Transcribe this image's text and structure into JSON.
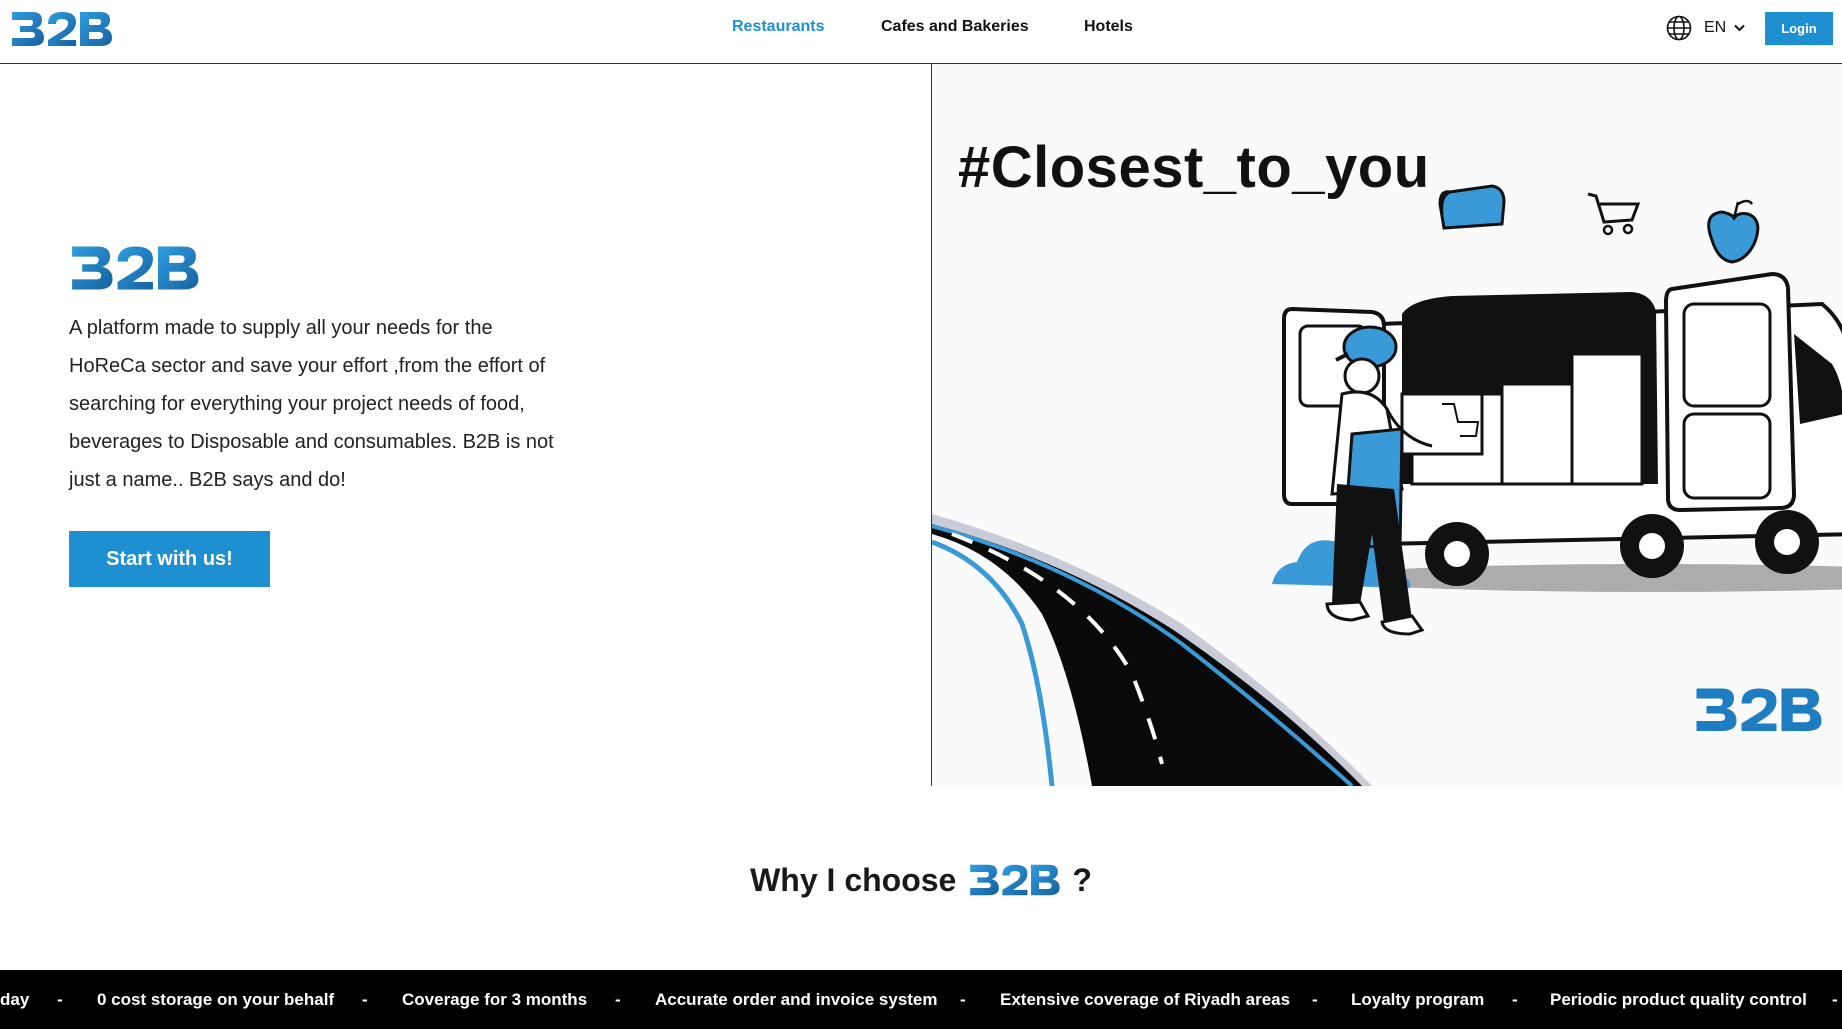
{
  "brand": {
    "name": "B2B",
    "primary_color": "#1e8fd0",
    "dark_color": "#1a5f99"
  },
  "header": {
    "nav": [
      {
        "label": "Restaurants",
        "active": true
      },
      {
        "label": "Cafes and Bakeries",
        "active": false
      },
      {
        "label": "Hotels",
        "active": false
      }
    ],
    "language": {
      "icon": "globe-icon",
      "label": "EN"
    },
    "login_label": "Login"
  },
  "hero": {
    "description": "A platform made to supply all your needs for the HoReCa sector and save your effort ,from the effort of searching for everything your project needs of food, beverages to Disposable and consumables. B2B is not just a name.. B2B says and do!",
    "cta_label": "Start with us!",
    "image_hashtag": "#Closest_to_you"
  },
  "why": {
    "title_prefix": "Why I choose",
    "title_suffix": "?"
  },
  "ticker": {
    "items": [
      "day",
      "0 cost storage on your behalf",
      "Coverage for 3 months",
      "Accurate order and invoice system",
      "Extensive coverage of Riyadh areas",
      "Loyalty program",
      "Periodic product quality control"
    ],
    "separator": "-"
  }
}
